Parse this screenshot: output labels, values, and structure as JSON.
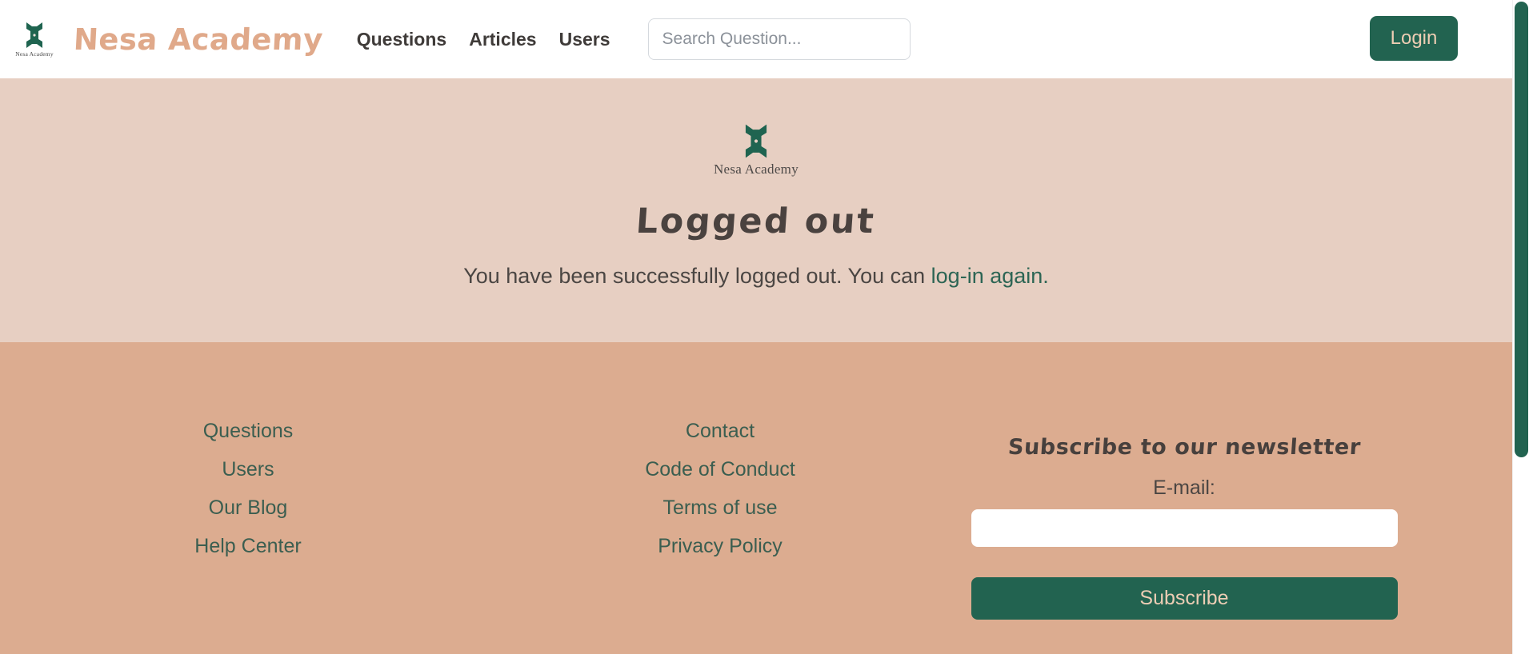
{
  "header": {
    "logo_icon": "nesa-bowtie-logo-icon",
    "logo_caption": "Nesa Academy",
    "brand_title": "Nesa Academy",
    "nav": [
      {
        "label": "Questions"
      },
      {
        "label": "Articles"
      },
      {
        "label": "Users"
      }
    ],
    "search": {
      "placeholder": "Search Question...",
      "value": ""
    },
    "login_label": "Login"
  },
  "hero": {
    "logo_icon": "nesa-bowtie-logo-icon",
    "logo_caption": "Nesa Academy",
    "title": "Logged out",
    "message_prefix": "You have been successfully logged out. You can ",
    "message_link": "log-in again."
  },
  "footer": {
    "column_one": [
      {
        "label": "Questions"
      },
      {
        "label": "Users"
      },
      {
        "label": "Our Blog"
      },
      {
        "label": "Help Center"
      }
    ],
    "column_two": [
      {
        "label": "Contact"
      },
      {
        "label": "Code of Conduct"
      },
      {
        "label": "Terms of use"
      },
      {
        "label": "Privacy Policy"
      }
    ],
    "newsletter": {
      "title": "Subscribe to our newsletter",
      "email_label": "E-mail:",
      "email_value": "",
      "email_placeholder": "",
      "subscribe_label": "Subscribe"
    }
  },
  "colors": {
    "brand_peach": "#e0a98a",
    "hero_bg": "#e7cfc2",
    "footer_bg": "#dcac90",
    "green": "#226350",
    "link_green": "#3b5e50",
    "text_dark": "#3f3b39"
  }
}
